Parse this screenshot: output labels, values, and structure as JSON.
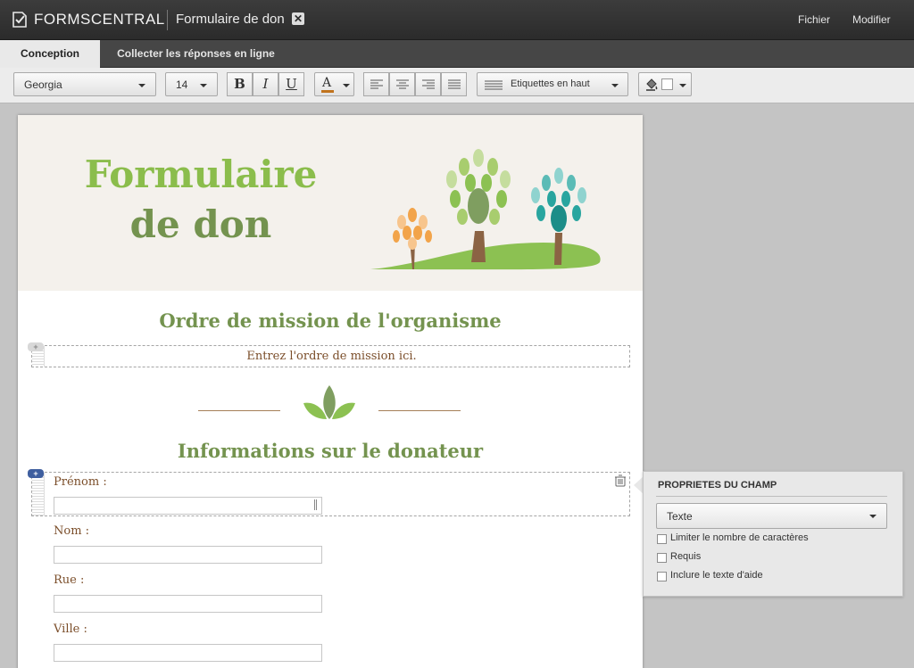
{
  "app": {
    "brand": "FORMSCENTRAL",
    "document_title": "Formulaire de don",
    "close_glyph": "✕",
    "menu": {
      "file": "Fichier",
      "edit": "Modifier"
    }
  },
  "tabs": [
    {
      "label": "Conception",
      "active": true
    },
    {
      "label": "Collecter les réponses en ligne",
      "active": false
    }
  ],
  "toolbar": {
    "font_family": "Georgia",
    "font_size": "14",
    "bold": "B",
    "italic": "I",
    "underline": "U",
    "text_color_glyph": "A",
    "label_position": "Etiquettes en haut",
    "accent_colors": {
      "text_color": "#c0731d",
      "fill_color": "#ffffff"
    }
  },
  "form": {
    "banner_line1": "Formulaire",
    "banner_line2": "de don",
    "mission_heading": "Ordre de mission de l'organisme",
    "mission_placeholder": "Entrez l'ordre de mission ici.",
    "donor_heading": "Informations sur le donateur",
    "fields": [
      {
        "label": "Prénom :",
        "value": ""
      },
      {
        "label": "Nom :",
        "value": ""
      },
      {
        "label": "Rue :",
        "value": ""
      },
      {
        "label": "Ville :",
        "value": ""
      }
    ],
    "colors": {
      "title_light_green": "#8bbd4c",
      "title_dark_green": "#74934f",
      "label_brown": "#7b4e2a",
      "banner_bg": "#f4f1ec"
    }
  },
  "properties": {
    "title": "PROPRIETES DU CHAMP",
    "field_type": "Texte",
    "options": [
      {
        "label": "Limiter le nombre de caractères",
        "checked": false
      },
      {
        "label": "Requis",
        "checked": false
      },
      {
        "label": "Inclure le texte d'aide",
        "checked": false
      }
    ]
  },
  "icons": [
    "check-document-icon",
    "close-icon",
    "chevron-down-icon",
    "paint-bucket-icon",
    "trash-icon",
    "plus-icon",
    "leaf-icon",
    "tree-icon"
  ]
}
